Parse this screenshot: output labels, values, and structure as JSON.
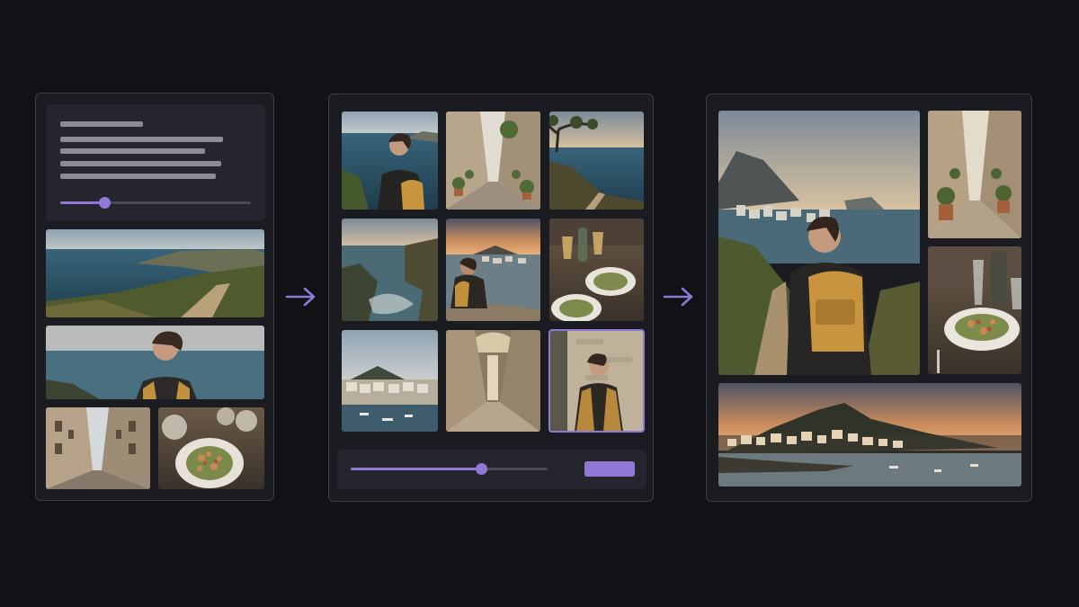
{
  "colors": {
    "background": "#111116",
    "panel": "#1b1b22",
    "panel_border": "#3d3d46",
    "inner_box": "#25252d",
    "accent": "#8f78d6",
    "text_placeholder": "#8c8c95"
  },
  "input_panel": {
    "prompt_lines": 5,
    "slider_value": 0.23,
    "reference_images": [
      "coastal-cliff-path",
      "woman-with-sea-view",
      "narrow-stone-street",
      "salad-dish-table"
    ]
  },
  "generation_panel": {
    "grid_columns": 3,
    "grid_rows": 3,
    "images": [
      "woman-backpack-sea",
      "alley-with-plants",
      "coastal-cliff-tree",
      "rocky-cove",
      "woman-overlooking-harbor",
      "wine-and-salad-table",
      "hilltop-town-harbor",
      "stone-archway-alley",
      "woman-against-wall"
    ],
    "selected_index": 8,
    "slider_value": 0.67
  },
  "output_panel": {
    "images": [
      "woman-on-coastal-path",
      "alley-with-potted-plants",
      "salad-and-wine",
      "sunset-hill-town"
    ]
  },
  "flow_arrows": [
    "arrow-to-generation",
    "arrow-to-output"
  ]
}
